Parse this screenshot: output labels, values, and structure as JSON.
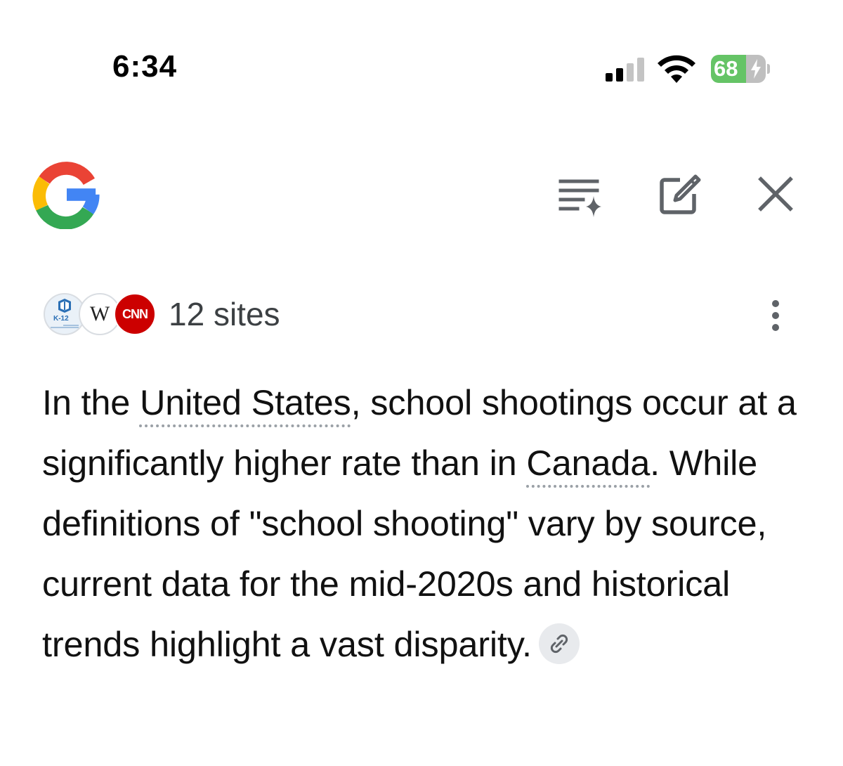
{
  "status_bar": {
    "time": "6:34",
    "battery_percent": "68",
    "battery_level": 0.68,
    "signal_bars_active": 2,
    "signal_bars_total": 4
  },
  "header": {
    "logo": "google-g-icon",
    "buttons": [
      {
        "name": "ai-list-icon"
      },
      {
        "name": "edit-icon"
      },
      {
        "name": "close-icon"
      }
    ]
  },
  "sources": {
    "favicons": [
      {
        "name": "k12-school-shooting-database-icon",
        "label": "K-12"
      },
      {
        "name": "wikipedia-icon",
        "letter": "W"
      },
      {
        "name": "cnn-icon",
        "letter": "CNN"
      }
    ],
    "count_label": "12 sites"
  },
  "answer": {
    "part1": "In the ",
    "entity1": "United States",
    "part2": ", school shootings occur at a significantly higher rate than in ",
    "entity2": "Canada",
    "part3": ". While definitions of \"school shooting\" vary by source, current data for the mid-2020s and historical trends highlight a vast disparity."
  },
  "colors": {
    "battery_green": "#65c466",
    "cnn_red": "#cc0000",
    "icon_gray": "#5f6368",
    "google_blue": "#4285F4",
    "google_red": "#EA4335",
    "google_yellow": "#FBBC05",
    "google_green": "#34A853"
  }
}
